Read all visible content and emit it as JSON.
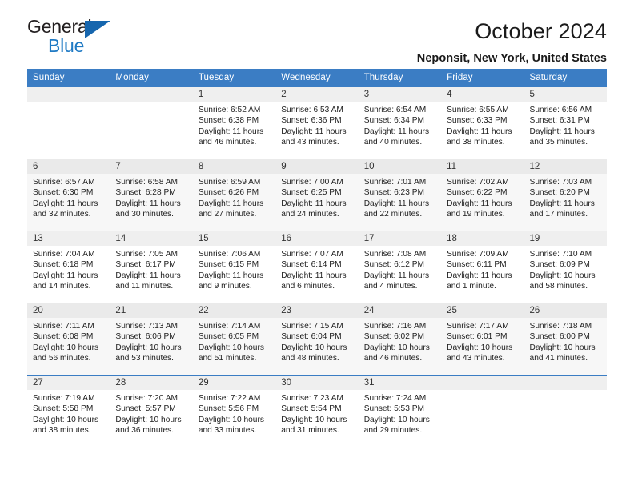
{
  "brand": {
    "name_part1": "General",
    "name_part2": "Blue",
    "logo_icon": "triangle-logo-icon"
  },
  "header": {
    "title": "October 2024",
    "location": "Neponsit, New York, United States"
  },
  "colors": {
    "header_blue": "#3b7dc4",
    "brand_blue": "#1f7ac4",
    "daynum_bg": "#efefef",
    "row_shaded_bg": "#f7f7f7"
  },
  "weekday_headers": [
    "Sunday",
    "Monday",
    "Tuesday",
    "Wednesday",
    "Thursday",
    "Friday",
    "Saturday"
  ],
  "weeks": [
    {
      "shaded": false,
      "days": [
        {
          "empty": true
        },
        {
          "empty": true
        },
        {
          "day": "1",
          "sunrise": "Sunrise: 6:52 AM",
          "sunset": "Sunset: 6:38 PM",
          "daylight1": "Daylight: 11 hours",
          "daylight2": "and 46 minutes."
        },
        {
          "day": "2",
          "sunrise": "Sunrise: 6:53 AM",
          "sunset": "Sunset: 6:36 PM",
          "daylight1": "Daylight: 11 hours",
          "daylight2": "and 43 minutes."
        },
        {
          "day": "3",
          "sunrise": "Sunrise: 6:54 AM",
          "sunset": "Sunset: 6:34 PM",
          "daylight1": "Daylight: 11 hours",
          "daylight2": "and 40 minutes."
        },
        {
          "day": "4",
          "sunrise": "Sunrise: 6:55 AM",
          "sunset": "Sunset: 6:33 PM",
          "daylight1": "Daylight: 11 hours",
          "daylight2": "and 38 minutes."
        },
        {
          "day": "5",
          "sunrise": "Sunrise: 6:56 AM",
          "sunset": "Sunset: 6:31 PM",
          "daylight1": "Daylight: 11 hours",
          "daylight2": "and 35 minutes."
        }
      ]
    },
    {
      "shaded": true,
      "days": [
        {
          "day": "6",
          "sunrise": "Sunrise: 6:57 AM",
          "sunset": "Sunset: 6:30 PM",
          "daylight1": "Daylight: 11 hours",
          "daylight2": "and 32 minutes."
        },
        {
          "day": "7",
          "sunrise": "Sunrise: 6:58 AM",
          "sunset": "Sunset: 6:28 PM",
          "daylight1": "Daylight: 11 hours",
          "daylight2": "and 30 minutes."
        },
        {
          "day": "8",
          "sunrise": "Sunrise: 6:59 AM",
          "sunset": "Sunset: 6:26 PM",
          "daylight1": "Daylight: 11 hours",
          "daylight2": "and 27 minutes."
        },
        {
          "day": "9",
          "sunrise": "Sunrise: 7:00 AM",
          "sunset": "Sunset: 6:25 PM",
          "daylight1": "Daylight: 11 hours",
          "daylight2": "and 24 minutes."
        },
        {
          "day": "10",
          "sunrise": "Sunrise: 7:01 AM",
          "sunset": "Sunset: 6:23 PM",
          "daylight1": "Daylight: 11 hours",
          "daylight2": "and 22 minutes."
        },
        {
          "day": "11",
          "sunrise": "Sunrise: 7:02 AM",
          "sunset": "Sunset: 6:22 PM",
          "daylight1": "Daylight: 11 hours",
          "daylight2": "and 19 minutes."
        },
        {
          "day": "12",
          "sunrise": "Sunrise: 7:03 AM",
          "sunset": "Sunset: 6:20 PM",
          "daylight1": "Daylight: 11 hours",
          "daylight2": "and 17 minutes."
        }
      ]
    },
    {
      "shaded": false,
      "days": [
        {
          "day": "13",
          "sunrise": "Sunrise: 7:04 AM",
          "sunset": "Sunset: 6:18 PM",
          "daylight1": "Daylight: 11 hours",
          "daylight2": "and 14 minutes."
        },
        {
          "day": "14",
          "sunrise": "Sunrise: 7:05 AM",
          "sunset": "Sunset: 6:17 PM",
          "daylight1": "Daylight: 11 hours",
          "daylight2": "and 11 minutes."
        },
        {
          "day": "15",
          "sunrise": "Sunrise: 7:06 AM",
          "sunset": "Sunset: 6:15 PM",
          "daylight1": "Daylight: 11 hours",
          "daylight2": "and 9 minutes."
        },
        {
          "day": "16",
          "sunrise": "Sunrise: 7:07 AM",
          "sunset": "Sunset: 6:14 PM",
          "daylight1": "Daylight: 11 hours",
          "daylight2": "and 6 minutes."
        },
        {
          "day": "17",
          "sunrise": "Sunrise: 7:08 AM",
          "sunset": "Sunset: 6:12 PM",
          "daylight1": "Daylight: 11 hours",
          "daylight2": "and 4 minutes."
        },
        {
          "day": "18",
          "sunrise": "Sunrise: 7:09 AM",
          "sunset": "Sunset: 6:11 PM",
          "daylight1": "Daylight: 11 hours",
          "daylight2": "and 1 minute."
        },
        {
          "day": "19",
          "sunrise": "Sunrise: 7:10 AM",
          "sunset": "Sunset: 6:09 PM",
          "daylight1": "Daylight: 10 hours",
          "daylight2": "and 58 minutes."
        }
      ]
    },
    {
      "shaded": true,
      "days": [
        {
          "day": "20",
          "sunrise": "Sunrise: 7:11 AM",
          "sunset": "Sunset: 6:08 PM",
          "daylight1": "Daylight: 10 hours",
          "daylight2": "and 56 minutes."
        },
        {
          "day": "21",
          "sunrise": "Sunrise: 7:13 AM",
          "sunset": "Sunset: 6:06 PM",
          "daylight1": "Daylight: 10 hours",
          "daylight2": "and 53 minutes."
        },
        {
          "day": "22",
          "sunrise": "Sunrise: 7:14 AM",
          "sunset": "Sunset: 6:05 PM",
          "daylight1": "Daylight: 10 hours",
          "daylight2": "and 51 minutes."
        },
        {
          "day": "23",
          "sunrise": "Sunrise: 7:15 AM",
          "sunset": "Sunset: 6:04 PM",
          "daylight1": "Daylight: 10 hours",
          "daylight2": "and 48 minutes."
        },
        {
          "day": "24",
          "sunrise": "Sunrise: 7:16 AM",
          "sunset": "Sunset: 6:02 PM",
          "daylight1": "Daylight: 10 hours",
          "daylight2": "and 46 minutes."
        },
        {
          "day": "25",
          "sunrise": "Sunrise: 7:17 AM",
          "sunset": "Sunset: 6:01 PM",
          "daylight1": "Daylight: 10 hours",
          "daylight2": "and 43 minutes."
        },
        {
          "day": "26",
          "sunrise": "Sunrise: 7:18 AM",
          "sunset": "Sunset: 6:00 PM",
          "daylight1": "Daylight: 10 hours",
          "daylight2": "and 41 minutes."
        }
      ]
    },
    {
      "shaded": false,
      "days": [
        {
          "day": "27",
          "sunrise": "Sunrise: 7:19 AM",
          "sunset": "Sunset: 5:58 PM",
          "daylight1": "Daylight: 10 hours",
          "daylight2": "and 38 minutes."
        },
        {
          "day": "28",
          "sunrise": "Sunrise: 7:20 AM",
          "sunset": "Sunset: 5:57 PM",
          "daylight1": "Daylight: 10 hours",
          "daylight2": "and 36 minutes."
        },
        {
          "day": "29",
          "sunrise": "Sunrise: 7:22 AM",
          "sunset": "Sunset: 5:56 PM",
          "daylight1": "Daylight: 10 hours",
          "daylight2": "and 33 minutes."
        },
        {
          "day": "30",
          "sunrise": "Sunrise: 7:23 AM",
          "sunset": "Sunset: 5:54 PM",
          "daylight1": "Daylight: 10 hours",
          "daylight2": "and 31 minutes."
        },
        {
          "day": "31",
          "sunrise": "Sunrise: 7:24 AM",
          "sunset": "Sunset: 5:53 PM",
          "daylight1": "Daylight: 10 hours",
          "daylight2": "and 29 minutes."
        },
        {
          "empty": true
        },
        {
          "empty": true
        }
      ]
    }
  ]
}
